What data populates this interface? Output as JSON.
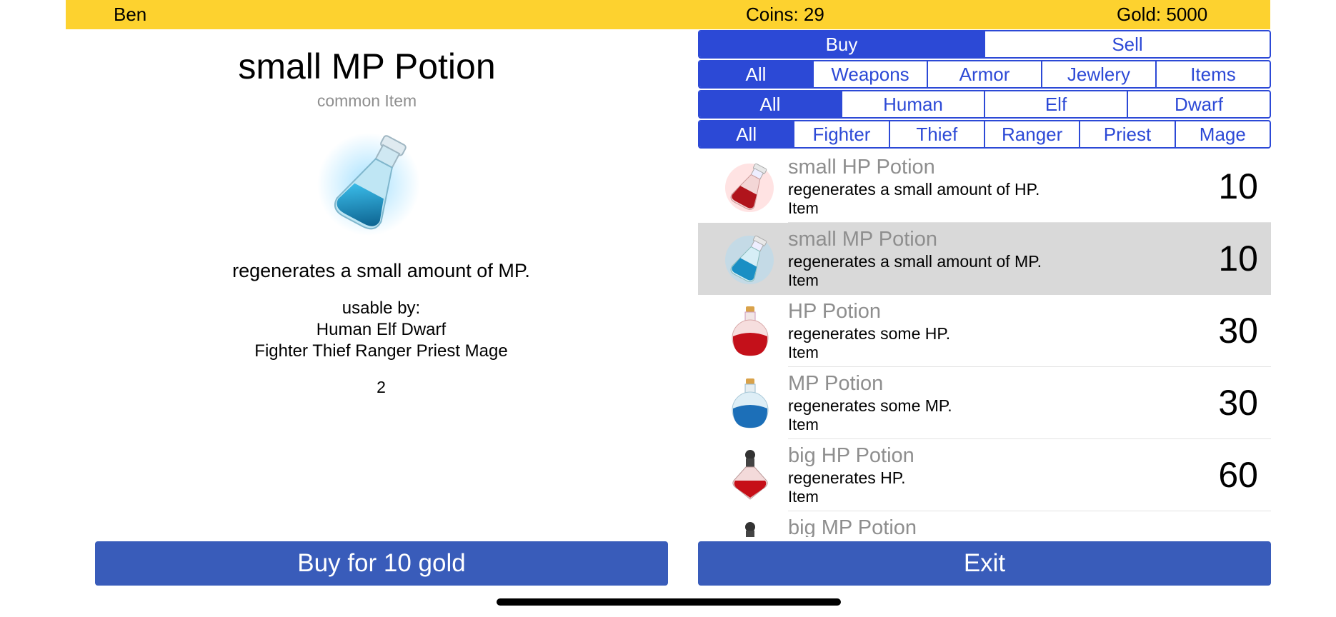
{
  "header": {
    "player_name": "Ben",
    "coins": "Coins: 29",
    "gold": "Gold:  5000"
  },
  "detail": {
    "title": "small MP Potion",
    "rarity": "common Item",
    "description": "regenerates a small amount of MP.",
    "usable_label": "usable by:",
    "races": "Human Elf Dwarf",
    "classes": "Fighter Thief Ranger Priest Mage",
    "quantity": "2",
    "buy_label": "Buy for 10 gold"
  },
  "exit_label": "Exit",
  "mode_tabs": [
    {
      "label": "Buy",
      "selected": true
    },
    {
      "label": "Sell",
      "selected": false
    }
  ],
  "category_tabs": [
    {
      "label": "All",
      "selected": true
    },
    {
      "label": "Weapons"
    },
    {
      "label": "Armor"
    },
    {
      "label": "Jewlery"
    },
    {
      "label": "Items"
    }
  ],
  "race_tabs": [
    {
      "label": "All",
      "selected": true
    },
    {
      "label": "Human"
    },
    {
      "label": "Elf"
    },
    {
      "label": "Dwarf"
    }
  ],
  "class_tabs": [
    {
      "label": "All",
      "selected": true
    },
    {
      "label": "Fighter"
    },
    {
      "label": "Thief"
    },
    {
      "label": "Ranger"
    },
    {
      "label": "Priest"
    },
    {
      "label": "Mage"
    }
  ],
  "items": [
    {
      "name": "small HP Potion",
      "description": "regenerates a small amount of HP.",
      "type": "Item",
      "price": "10",
      "icon": "small-hp-potion-icon"
    },
    {
      "name": "small MP Potion",
      "description": "regenerates a small amount of MP.",
      "type": "Item",
      "price": "10",
      "icon": "small-mp-potion-icon",
      "selected": true
    },
    {
      "name": "HP Potion",
      "description": "regenerates some HP.",
      "type": "Item",
      "price": "30",
      "icon": "hp-potion-icon"
    },
    {
      "name": "MP Potion",
      "description": "regenerates some MP.",
      "type": "Item",
      "price": "30",
      "icon": "mp-potion-icon"
    },
    {
      "name": "big HP Potion",
      "description": "regenerates HP.",
      "type": "Item",
      "price": "60",
      "icon": "big-hp-potion-icon"
    },
    {
      "name": "big MP Potion",
      "description": "",
      "type": "",
      "price": "",
      "icon": "big-mp-potion-icon"
    }
  ],
  "colors": {
    "header_bg": "#fdd22f",
    "accent": "#2c49d6",
    "button": "#395cba",
    "selected_row": "#d9d9d9"
  }
}
